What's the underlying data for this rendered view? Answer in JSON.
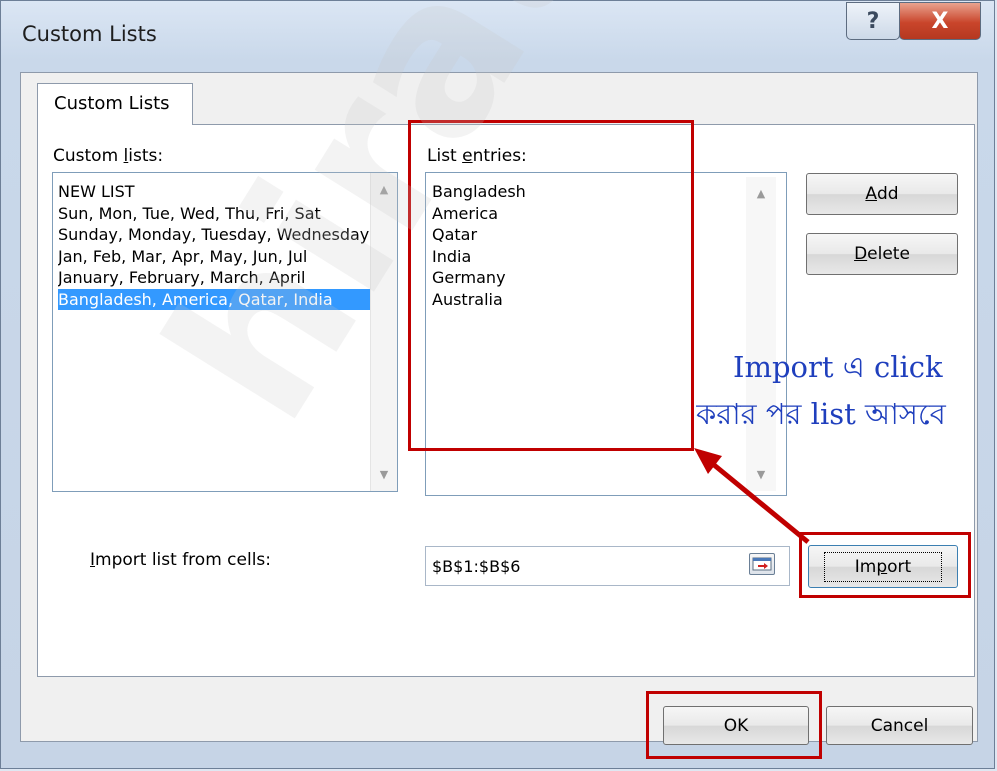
{
  "window": {
    "title": "Custom Lists",
    "help_label": "?",
    "close_label": "X"
  },
  "tab": {
    "label": "Custom Lists"
  },
  "custom_lists": {
    "label_pre": "Custom ",
    "label_key": "l",
    "label_post": "ists:",
    "items": [
      "NEW LIST",
      "Sun, Mon, Tue, Wed, Thu, Fri, Sat",
      "Sunday, Monday, Tuesday, Wednesday",
      "Jan, Feb, Mar, Apr, May, Jun, Jul",
      "January, February, March, April",
      "Bangladesh, America, Qatar, India"
    ],
    "selected_index": 5
  },
  "list_entries": {
    "label_pre": "List ",
    "label_key": "e",
    "label_post": "ntries:",
    "items": [
      "Bangladesh",
      "America",
      "Qatar",
      "India",
      "Germany",
      "Australia"
    ]
  },
  "buttons": {
    "add_key": "A",
    "add_rest": "dd",
    "delete_key": "D",
    "delete_rest": "elete",
    "import_pre": "Im",
    "import_key": "p",
    "import_post": "ort",
    "ok": "OK",
    "cancel": "Cancel"
  },
  "import_field": {
    "label_key": "I",
    "label_rest": "mport list from cells:",
    "value": "$B$1:$B$6"
  },
  "annotation": {
    "line1": "Import এ click",
    "line2": "করার পর list আসবে",
    "color": "#1f3fbd",
    "highlight_color": "#c00000"
  },
  "watermark": {
    "text": "hiratg.blo"
  }
}
